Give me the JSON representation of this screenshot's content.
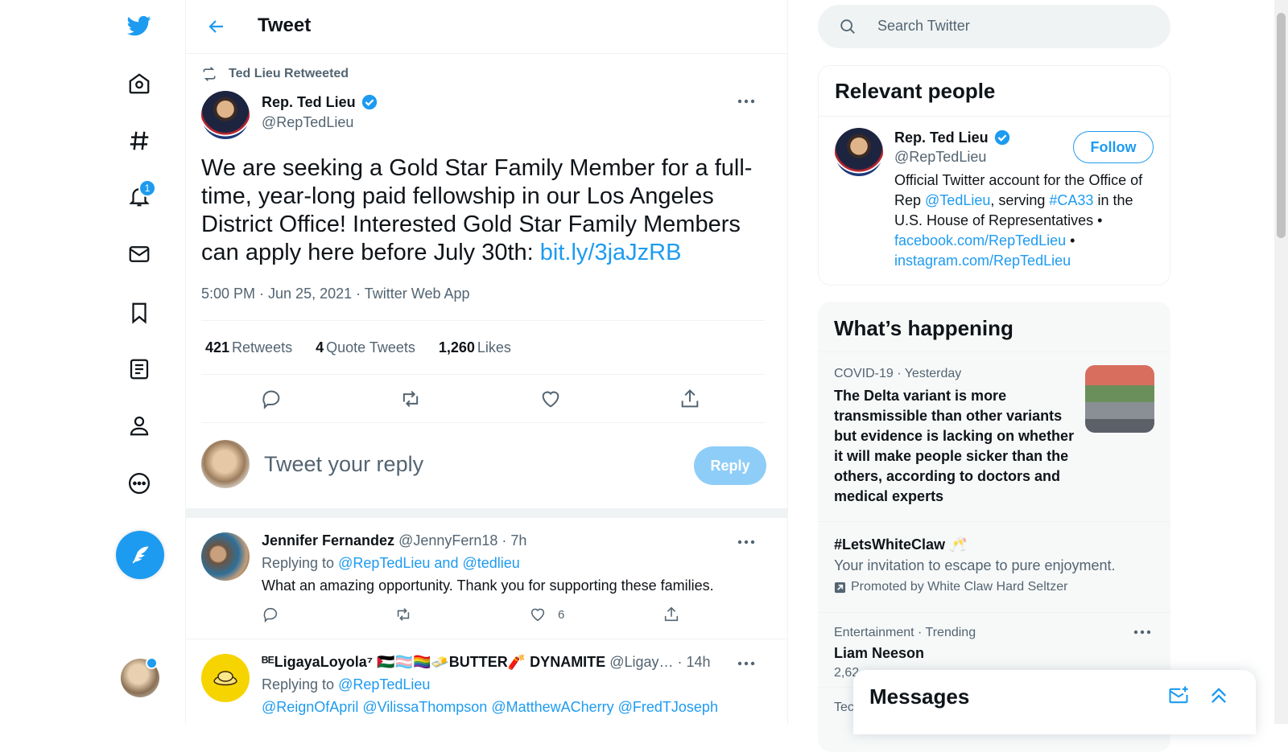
{
  "nav": {
    "notifications_badge": "1"
  },
  "header": {
    "title": "Tweet"
  },
  "tweet": {
    "retweeted_by": "Ted Lieu Retweeted",
    "author_name": "Rep. Ted Lieu",
    "author_handle": "@RepTedLieu",
    "text": "We are seeking a Gold Star Family Member for a full-time, year-long paid fellowship in our Los Angeles District Office! Interested Gold Star Family Members can apply here before July 30th: ",
    "link": "bit.ly/3jaJzRB",
    "meta": "5:00 PM · Jun 25, 2021 · Twitter Web App",
    "retweets_count": "421",
    "retweets_label": "Retweets",
    "quotes_count": "4",
    "quotes_label": "Quote Tweets",
    "likes_count": "1,260",
    "likes_label": "Likes"
  },
  "reply_box": {
    "placeholder": "Tweet your reply",
    "button_label": "Reply"
  },
  "replies": [
    {
      "name": "Jennifer Fernandez",
      "handle": "@JennyFern18",
      "time": "· 7h",
      "replying_label": "Replying to",
      "replying_to": "@RepTedLieu and @tedlieu",
      "text": "What an amazing opportunity. Thank you for supporting these families.",
      "likes": "6"
    },
    {
      "name": "ᴮᴱLigayaLoyola⁷ 🇵🇸🏳️‍⚧️🏳️‍🌈🧈BUTTER🧨 DYNAMITE",
      "handle": "@Ligay…",
      "time": "· 14h",
      "replying_label": "Replying to",
      "replying_to": "@RepTedLieu",
      "text": "@ReignOfApril @VilissaThompson @MatthewACherry @FredTJoseph"
    }
  ],
  "search": {
    "placeholder": "Search Twitter"
  },
  "relevant_people": {
    "title": "Relevant people",
    "name": "Rep. Ted Lieu",
    "handle": "@RepTedLieu",
    "follow_label": "Follow",
    "bio_1": "Official Twitter account for the Office of Rep ",
    "bio_mention": "@TedLieu",
    "bio_2": ", serving ",
    "bio_hashtag": "#CA33",
    "bio_3": " in the U.S. House of Representatives • ",
    "bio_link1": "facebook.com/RepTedLieu",
    "bio_4": " • ",
    "bio_link2": "instagram.com/RepTedLieu"
  },
  "happening": {
    "title": "What’s happening",
    "trends": [
      {
        "meta": "COVID-19 · Yesterday",
        "title": "The Delta variant is more transmissible than other variants but evidence is lacking on whether it will make people sicker than the others, according to doctors and medical experts"
      },
      {
        "title": "#LetsWhiteClaw 🥂",
        "desc": "Your invitation to escape to pure enjoyment.",
        "promoted": "Promoted by White Claw Hard Seltzer"
      },
      {
        "meta": "Entertainment · Trending",
        "title": "Liam Neeson",
        "count": "2,62"
      },
      {
        "meta": "Tec"
      }
    ]
  },
  "messages": {
    "title": "Messages"
  },
  "colors": {
    "accent": "#1d9bf0",
    "text": "#0f1419",
    "secondary": "#536471"
  }
}
